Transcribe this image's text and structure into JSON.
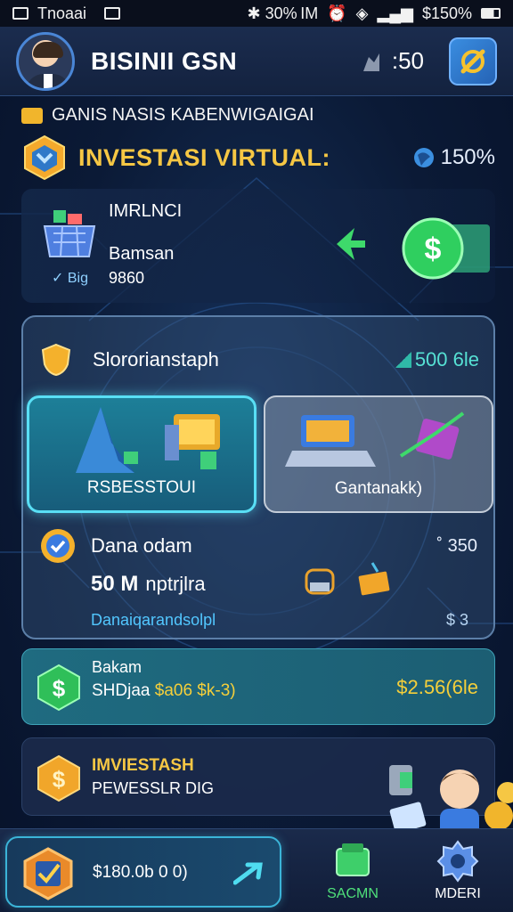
{
  "status_bar": {
    "left_text": "Tnoaai",
    "right_text": "✱ 30% IM",
    "battery_text": "$150%"
  },
  "header": {
    "user_name": "BISINII GSN",
    "stat_value": ":50"
  },
  "subtitle": "GANIS NASIS KABENWIGAIGAI",
  "title_row": {
    "title": "INVESTASI VIRTUAL:",
    "percent": "150%"
  },
  "investment_card": {
    "label_top": "IMRLNCI",
    "label_middle": "Bamsan",
    "label_bottom": "9860",
    "tags": "✓ Big"
  },
  "portfolio_panel": {
    "header_label": "Slororianstaph",
    "header_value": "500 6le",
    "options": [
      {
        "label": "RSBESSTOUI",
        "selected": true
      },
      {
        "label": "Gantanakk)",
        "selected": false
      }
    ],
    "pass_row": {
      "label": "Dana odam",
      "value": "˚ 350"
    },
    "main_value": "50 M",
    "main_suffix": "nptrjlra",
    "footer_label": "Danaiqarandsolpl",
    "footer_value": "$ 3"
  },
  "account_card": {
    "line1": "Bakam",
    "line2_prefix": "SHDjaa",
    "line2_highlight": "$a06 $k-3)",
    "amount": "$2.56(6le"
  },
  "invest_card": {
    "line1": "IMVIESTASH",
    "line2": "PEWESSLR DIG"
  },
  "bottom_nav": {
    "main_label": "$180.0b 0 0)",
    "button1": "SACMN",
    "button2": "MDERI"
  },
  "colors": {
    "background": "#0b1a36",
    "accent_gold": "#f6c744",
    "accent_cyan": "#59dff5",
    "accent_green": "#4fe07a"
  },
  "icons": {
    "status_bar": [
      "image-icon",
      "gallery-icon",
      "bluetooth-icon",
      "alarm-icon",
      "wifi-icon",
      "signal-icon",
      "battery-icon"
    ],
    "header": [
      "avatar",
      "user-stat-icon",
      "tools-icon"
    ],
    "content": [
      "folder-icon",
      "emblem-icon",
      "globe-icon",
      "basket-icon",
      "arrow-icon",
      "dollar-coin-icon",
      "shield-icon",
      "check-badge-icon",
      "dollar-icon",
      "coin-icon",
      "can-icon",
      "mascot-icon"
    ],
    "nav": [
      "checkbox-icon",
      "arrow-right-icon",
      "stack-icon",
      "gear-icon"
    ]
  }
}
